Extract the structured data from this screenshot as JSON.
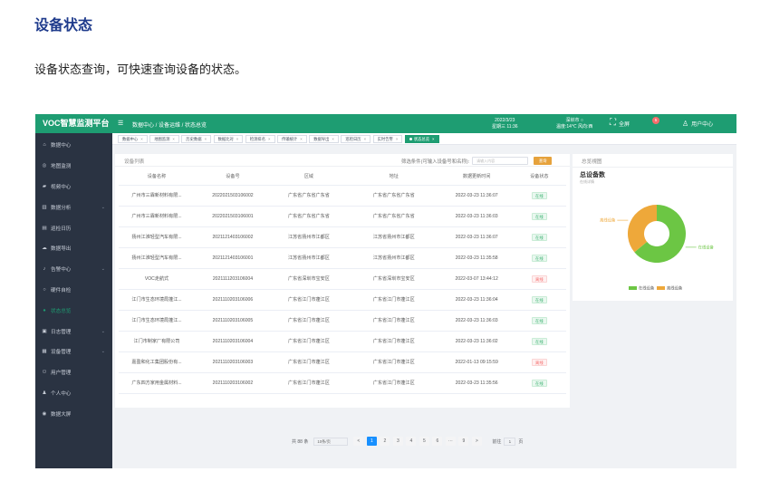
{
  "doc": {
    "title": "设备状态",
    "description": "设备状态查询，可快速查询设备的状态。"
  },
  "app": {
    "brand": "VOC智慧监测平台",
    "header": {
      "breadcrumb": "数据中心 / 设备运维 / 状态总览",
      "date": "2022/3/23",
      "weekday_time": "星期三 11:36",
      "city": "深圳市 ○",
      "weather": "温度:14℃ 风向:西",
      "fullscreen_label": "全屏",
      "notification_count": "5",
      "user_label": "用户中心"
    },
    "sidebar": [
      {
        "label": "数据中心",
        "icon": "home-icon",
        "caret": false,
        "active": false
      },
      {
        "label": "地图监测",
        "icon": "map-icon",
        "caret": false,
        "active": false
      },
      {
        "label": "视频中心",
        "icon": "video-icon",
        "caret": false,
        "active": false
      },
      {
        "label": "数据分析",
        "icon": "chart-icon",
        "caret": true,
        "active": false
      },
      {
        "label": "巡检日历",
        "icon": "calendar-icon",
        "caret": false,
        "active": false
      },
      {
        "label": "数据导出",
        "icon": "export-icon",
        "caret": false,
        "active": false
      },
      {
        "label": "告警中心",
        "icon": "bell-icon",
        "caret": true,
        "active": false
      },
      {
        "label": "硬件自检",
        "icon": "circle-icon",
        "caret": false,
        "active": false
      },
      {
        "label": "状态总览",
        "icon": "status-icon",
        "caret": false,
        "active": true
      },
      {
        "label": "日志管理",
        "icon": "log-icon",
        "caret": true,
        "active": false
      },
      {
        "label": "设备管理",
        "icon": "device-icon",
        "caret": true,
        "active": false
      },
      {
        "label": "用户管理",
        "icon": "users-icon",
        "caret": false,
        "active": false
      },
      {
        "label": "个人中心",
        "icon": "person-icon",
        "caret": false,
        "active": false
      },
      {
        "label": "数据大屏",
        "icon": "screen-icon",
        "caret": false,
        "active": false
      }
    ],
    "tabs": [
      {
        "label": "数据中心",
        "active": false
      },
      {
        "label": "地图监测",
        "active": false
      },
      {
        "label": "历史数据",
        "active": false
      },
      {
        "label": "数据比对",
        "active": false
      },
      {
        "label": "检测排名",
        "active": false
      },
      {
        "label": "传输统计",
        "active": false
      },
      {
        "label": "数据导出",
        "active": false
      },
      {
        "label": "巡检日历",
        "active": false
      },
      {
        "label": "实时告警",
        "active": false
      },
      {
        "label": "状态总览",
        "active": true
      }
    ],
    "list": {
      "title": "设备列表",
      "filter_label": "筛选条件(可输入设备号和名称):",
      "filter_placeholder": "请输入内容",
      "search_label": "查询",
      "columns": [
        "设备名称",
        "设备号",
        "区域",
        "地址",
        "数据更新时间",
        "设备状态"
      ],
      "rows": [
        {
          "name": "广州市三霖新材料有限...",
          "id": "2022021503106002",
          "area": "广东省广东省广东省",
          "addr": "广东省广东省广东省",
          "time": "2022-03-23 11:36:07",
          "status": "在线",
          "online": true
        },
        {
          "name": "广州市三霖新材料有限...",
          "id": "2022021503106001",
          "area": "广东省广东省广东省",
          "addr": "广东省广东省广东省",
          "time": "2022-03-23 11:36:03",
          "status": "在线",
          "online": true
        },
        {
          "name": "扬州江淮轻型汽车有限...",
          "id": "2021121403106002",
          "area": "江苏省扬州市江都区",
          "addr": "江苏省扬州市江都区",
          "time": "2022-03-23 11:36:07",
          "status": "在线",
          "online": true
        },
        {
          "name": "扬州江淮轻型汽车有限...",
          "id": "2021121403106001",
          "area": "江苏省扬州市江都区",
          "addr": "江苏省扬州市江都区",
          "time": "2022-03-23 11:35:58",
          "status": "在线",
          "online": true
        },
        {
          "name": "VOC走航式",
          "id": "2021111203106004",
          "area": "广东省深圳市宝安区",
          "addr": "广东省深圳市宝安区",
          "time": "2022-03-07 13:44:12",
          "status": "离线",
          "online": false
        },
        {
          "name": "江门市生态环境局蓬江...",
          "id": "2021110203106006",
          "area": "广东省江门市蓬江区",
          "addr": "广东省江门市蓬江区",
          "time": "2022-03-23 11:36:04",
          "status": "在线",
          "online": true
        },
        {
          "name": "江门市生态环境局蓬江...",
          "id": "2021110203106005",
          "area": "广东省江门市蓬江区",
          "addr": "广东省江门市蓬江区",
          "time": "2022-03-23 11:36:03",
          "status": "在线",
          "online": true
        },
        {
          "name": "江门市制家厂有限公司",
          "id": "2021110203106004",
          "area": "广东省江门市蓬江区",
          "addr": "广东省江门市蓬江区",
          "time": "2022-03-23 11:36:02",
          "status": "在线",
          "online": true
        },
        {
          "name": "嘉盈和化工集团股份有...",
          "id": "2021110203106003",
          "area": "广东省江门市蓬江区",
          "addr": "广东省江门市蓬江区",
          "time": "2022-01-13 09:15:59",
          "status": "离线",
          "online": false
        },
        {
          "name": "广东四方家用金属材料...",
          "id": "2021110203106002",
          "area": "广东省江门市蓬江区",
          "addr": "广东省江门市蓬江区",
          "time": "2022-03-23 11:35:56",
          "status": "在线",
          "online": true
        }
      ],
      "pager": {
        "total": "共 88 条",
        "page_size": "10条/页",
        "prev": "<",
        "pages": [
          "1",
          "2",
          "3",
          "4",
          "5",
          "6",
          "···",
          "9"
        ],
        "current": "1",
        "next": ">",
        "goto_label": "前往",
        "goto_value": "1",
        "goto_suffix": "页"
      }
    },
    "overview": {
      "title": "总览視图",
      "heading": "总设备数",
      "subheading": "在线详情",
      "legend_online": "在线设备",
      "legend_offline": "离线设备",
      "colors": {
        "online": "#6cc644",
        "offline": "#eea83a"
      }
    }
  },
  "chart_data": {
    "type": "pie",
    "title": "总设备数",
    "categories": [
      "在线设备",
      "离线设备"
    ],
    "values": [
      64,
      36
    ],
    "legend": "bottom"
  }
}
